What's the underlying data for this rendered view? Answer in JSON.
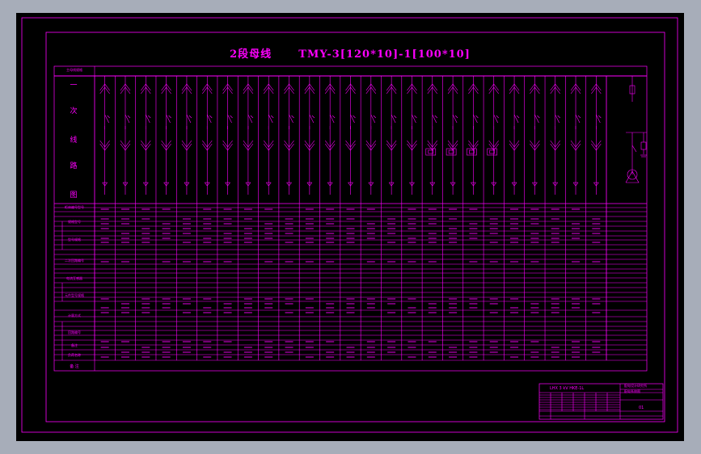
{
  "title": "2段母线      TMY-3[120*10]-1[100*10]",
  "section_header": "主母线规格",
  "vertical_label_chars": [
    "一",
    "次",
    "线",
    "路",
    "图"
  ],
  "row_labels": [
    "柜体编号型号",
    "规格型号",
    "型号规格",
    "二次回路编号",
    "电流互感器",
    "元件型号规格",
    "计量方式",
    "回路编号",
    "备注",
    "负荷名称"
  ],
  "footer_label": "备 注",
  "title_block": {
    "project": "LHX 3 kV HKE-1L",
    "company": "配电设计研究所",
    "row2": "配电系统图",
    "code": "01"
  },
  "colors": {
    "background": "#000000",
    "line": "#ff00ff",
    "outer": "#a7adb9"
  }
}
